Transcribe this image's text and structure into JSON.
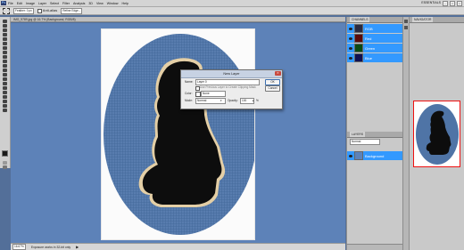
{
  "menubar": {
    "app_logo": "Ps",
    "items": [
      "File",
      "Edit",
      "Image",
      "Layer",
      "Select",
      "Filter",
      "Analysis",
      "3D",
      "View",
      "Window",
      "Help"
    ],
    "workspace": "ESSENTIALS",
    "window_controls": [
      "–",
      "□",
      "×"
    ]
  },
  "options": {
    "feather_label": "Feather: 0 px",
    "antialias_label": "Anti-alias",
    "refine_label": "Refine Edge..."
  },
  "document": {
    "tab_title": "IMG_9789.jpg @ 16.7% (Background, RGB/8)",
    "zoom": "16.67%",
    "doc_info": "Exposure works in 32-bit only"
  },
  "dialog": {
    "title": "New Layer",
    "name_label": "Name:",
    "name_value": "Layer 0",
    "clip_label": "Use Previous Layer to Create Clipping Mask",
    "color_label": "Color:",
    "color_value": "None",
    "mode_label": "Mode:",
    "mode_value": "Normal",
    "opacity_label": "Opacity:",
    "opacity_value": "100",
    "opacity_unit": "%",
    "ok": "OK",
    "cancel": "Cancel"
  },
  "channels_panel": {
    "tab": "CHANNELS",
    "rows": [
      "RGB",
      "Red",
      "Green",
      "Blue"
    ]
  },
  "layers_panel": {
    "tab": "LAYERS",
    "blend": "Normal",
    "layer_name": "Background"
  },
  "navigator_panel": {
    "tab": "NAVIGATOR"
  },
  "colors": {
    "canvas": "#5d82b8",
    "highlight": "#3399ff",
    "nav_frame": "#ee1111"
  }
}
